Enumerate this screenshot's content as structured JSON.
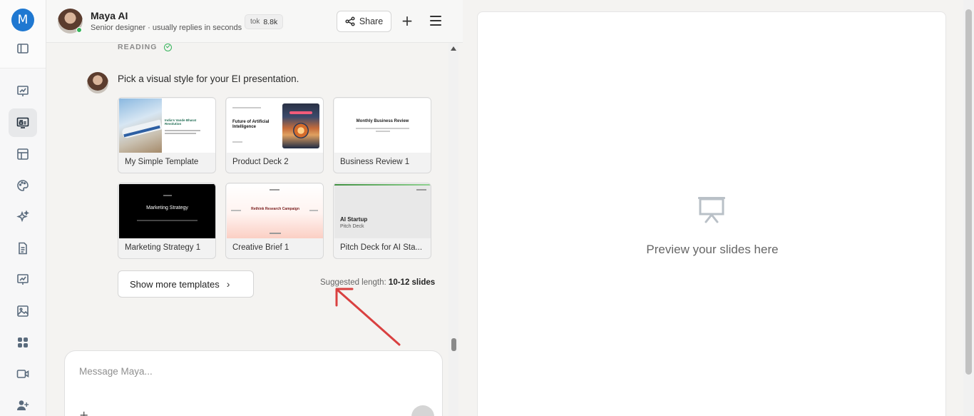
{
  "rail": {
    "avatar_letter": "M",
    "items": [
      {
        "icon": "sidebar-toggle-icon"
      },
      {
        "icon": "chart-presentation-icon"
      },
      {
        "icon": "slides-icon",
        "active": true
      },
      {
        "icon": "layout-icon"
      },
      {
        "icon": "palette-icon"
      },
      {
        "icon": "sparkles-icon"
      },
      {
        "icon": "document-icon"
      },
      {
        "icon": "presentation-icon"
      },
      {
        "icon": "image-icon"
      },
      {
        "icon": "apps-icon"
      },
      {
        "icon": "video-icon"
      },
      {
        "icon": "add-user-icon"
      }
    ]
  },
  "header": {
    "name": "Maya AI",
    "subtitle": "Senior designer · usually replies in seconds",
    "tok_label": "tok",
    "tok_value": "8.8k",
    "share_label": "Share"
  },
  "chat": {
    "status": "READING",
    "message": "Pick a visual style for your EI presentation.",
    "templates": [
      {
        "label": "My Simple Template",
        "thumb_title": "India's Vande Bharat Revolution"
      },
      {
        "label": "Product Deck 2",
        "thumb_title": "Future of Artificial Intelligence"
      },
      {
        "label": "Business Review 1",
        "thumb_title": "Monthly Business Review"
      },
      {
        "label": "Marketing Strategy 1",
        "thumb_title": "Marketing Strategy"
      },
      {
        "label": "Creative Brief 1",
        "thumb_title": "Rethink Research Campaign"
      },
      {
        "label": "Pitch Deck for AI Sta...",
        "thumb_title": "AI Startup",
        "thumb_sub": "Pitch Deck"
      }
    ],
    "show_more_label": "Show more templates",
    "suggest_prefix": "Suggested length: ",
    "suggest_value": "10-12 slides",
    "composer_placeholder": "Message Maya..."
  },
  "preview": {
    "text": "Preview your slides here"
  },
  "colors": {
    "accent": "#1f78d1",
    "online": "#36b45b",
    "annotation_arrow": "#d94040"
  }
}
